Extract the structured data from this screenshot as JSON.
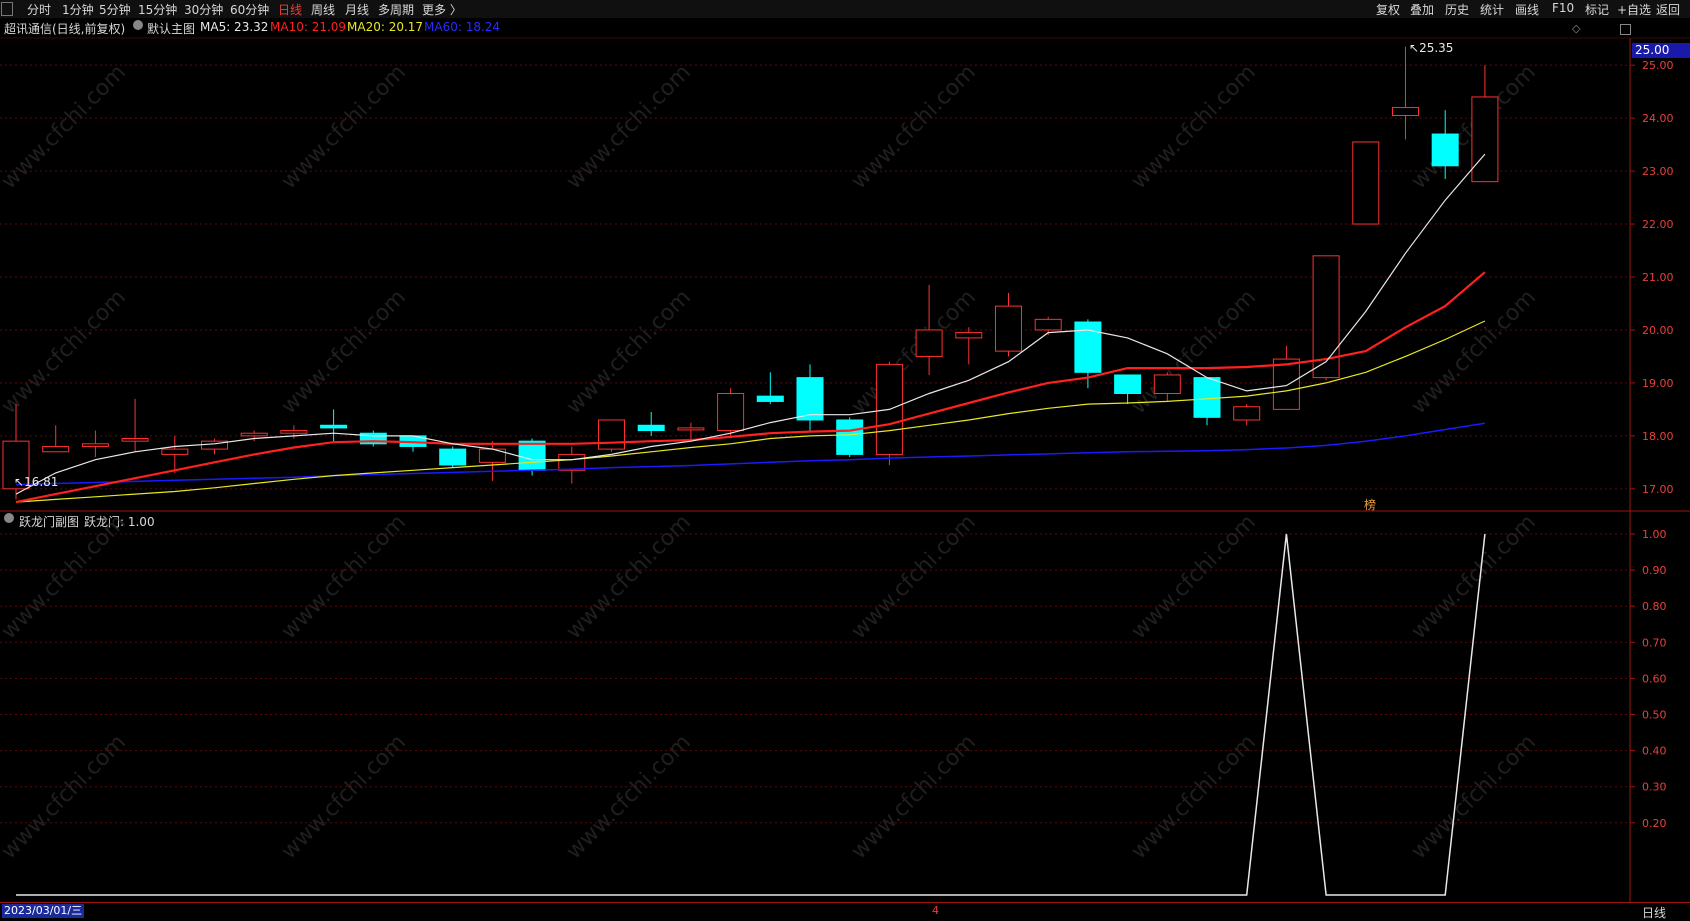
{
  "toolbar": {
    "left": [
      "分时",
      "1分钟",
      "5分钟",
      "15分钟",
      "30分钟",
      "60分钟",
      "日线",
      "周线",
      "月线",
      "多周期",
      "更多 〉"
    ],
    "active": "日线",
    "right": [
      "复权",
      "叠加",
      "历史",
      "统计",
      "画线",
      "F10",
      "标记",
      "+自选",
      "返回"
    ]
  },
  "info": {
    "stock": "超讯通信(日线,前复权)",
    "chart_name": "默认主图",
    "ma5": "MA5: 23.32",
    "ma10": "MA10: 21.09",
    "ma20": "MA20: 20.17",
    "ma60": "MA60: 18.24"
  },
  "colors": {
    "ma5": "#e8e8e8",
    "ma10": "#ff2020",
    "ma20": "#e8e820",
    "ma60": "#1a1aff",
    "up": "#ff3030",
    "down": "#00ffff",
    "grid": "#5a0a0a",
    "frame": "#a01414"
  },
  "sub": {
    "name": "跃龙门副图",
    "value": "跃龙门: 1.00"
  },
  "labels": {
    "high": "25.35",
    "low": "16.81",
    "current_price": "25.00",
    "mark": "榜"
  },
  "status": {
    "date": "2023/03/01/三",
    "period": "日线",
    "marker": "4"
  },
  "watermark": "www.cfchi.com",
  "chart_data": [
    {
      "type": "candlestick",
      "yticks": [
        "25.00",
        "24.00",
        "23.00",
        "22.00",
        "21.00",
        "20.00",
        "19.00",
        "18.00",
        "17.00"
      ],
      "ylim": [
        16.6,
        25.4
      ],
      "candles": [
        {
          "o": 17.0,
          "c": 17.9,
          "h": 18.6,
          "l": 16.8
        },
        {
          "o": 17.7,
          "c": 17.8,
          "h": 18.2,
          "l": 17.7
        },
        {
          "o": 17.8,
          "c": 17.85,
          "h": 18.1,
          "l": 17.6
        },
        {
          "o": 17.9,
          "c": 17.95,
          "h": 18.7,
          "l": 17.7
        },
        {
          "o": 17.65,
          "c": 17.75,
          "h": 18.0,
          "l": 17.3
        },
        {
          "o": 17.75,
          "c": 17.9,
          "h": 17.95,
          "l": 17.65
        },
        {
          "o": 18.0,
          "c": 18.05,
          "h": 18.1,
          "l": 17.9
        },
        {
          "o": 18.05,
          "c": 18.1,
          "h": 18.2,
          "l": 17.95
        },
        {
          "o": 18.2,
          "c": 18.15,
          "h": 18.5,
          "l": 17.9
        },
        {
          "o": 18.05,
          "c": 17.85,
          "h": 18.1,
          "l": 17.8
        },
        {
          "o": 18.0,
          "c": 17.8,
          "h": 18.0,
          "l": 17.7
        },
        {
          "o": 17.75,
          "c": 17.45,
          "h": 17.8,
          "l": 17.4
        },
        {
          "o": 17.5,
          "c": 17.75,
          "h": 17.9,
          "l": 17.15
        },
        {
          "o": 17.9,
          "c": 17.35,
          "h": 17.95,
          "l": 17.25
        },
        {
          "o": 17.35,
          "c": 17.65,
          "h": 17.8,
          "l": 17.1
        },
        {
          "o": 17.75,
          "c": 18.3,
          "h": 18.3,
          "l": 17.7
        },
        {
          "o": 18.2,
          "c": 18.1,
          "h": 18.45,
          "l": 18.0
        },
        {
          "o": 18.15,
          "c": 18.15,
          "h": 18.25,
          "l": 17.9
        },
        {
          "o": 18.1,
          "c": 18.8,
          "h": 18.9,
          "l": 18.0
        },
        {
          "o": 18.75,
          "c": 18.65,
          "h": 19.2,
          "l": 18.6
        },
        {
          "o": 19.1,
          "c": 18.3,
          "h": 19.35,
          "l": 18.1
        },
        {
          "o": 18.3,
          "c": 17.65,
          "h": 18.35,
          "l": 17.6
        },
        {
          "o": 17.65,
          "c": 19.35,
          "h": 19.4,
          "l": 17.45
        },
        {
          "o": 19.5,
          "c": 20.0,
          "h": 20.85,
          "l": 19.15
        },
        {
          "o": 19.85,
          "c": 19.95,
          "h": 20.05,
          "l": 19.35
        },
        {
          "o": 19.6,
          "c": 20.45,
          "h": 20.7,
          "l": 19.5
        },
        {
          "o": 20.0,
          "c": 20.2,
          "h": 20.25,
          "l": 19.9
        },
        {
          "o": 20.15,
          "c": 19.2,
          "h": 20.2,
          "l": 18.9
        },
        {
          "o": 19.15,
          "c": 18.8,
          "h": 19.15,
          "l": 18.6
        },
        {
          "o": 18.8,
          "c": 19.15,
          "h": 19.2,
          "l": 18.65
        },
        {
          "o": 19.1,
          "c": 18.35,
          "h": 19.1,
          "l": 18.2
        },
        {
          "o": 18.3,
          "c": 18.55,
          "h": 18.6,
          "l": 18.2
        },
        {
          "o": 18.5,
          "c": 19.45,
          "h": 19.7,
          "l": 18.5
        },
        {
          "o": 19.1,
          "c": 21.4,
          "h": 21.4,
          "l": 19.05
        },
        {
          "o": 22.0,
          "c": 23.55,
          "h": 23.55,
          "l": 22.0
        },
        {
          "o": 24.05,
          "c": 24.2,
          "h": 25.35,
          "l": 23.6
        },
        {
          "o": 23.7,
          "c": 23.1,
          "h": 24.15,
          "l": 22.85
        },
        {
          "o": 22.8,
          "c": 24.4,
          "h": 25.0,
          "l": 22.8
        }
      ],
      "ma5": [
        16.9,
        17.3,
        17.55,
        17.7,
        17.8,
        17.85,
        17.95,
        18.0,
        18.05,
        18.0,
        18.0,
        17.85,
        17.75,
        17.55,
        17.55,
        17.65,
        17.8,
        17.9,
        18.05,
        18.25,
        18.4,
        18.4,
        18.5,
        18.8,
        19.05,
        19.4,
        19.95,
        20.0,
        19.85,
        19.55,
        19.1,
        18.85,
        18.95,
        19.4,
        20.35,
        21.45,
        22.45,
        23.32
      ],
      "ma10": [
        16.75,
        16.9,
        17.05,
        17.2,
        17.35,
        17.5,
        17.65,
        17.78,
        17.88,
        17.9,
        17.88,
        17.85,
        17.85,
        17.85,
        17.85,
        17.87,
        17.9,
        17.92,
        17.98,
        18.05,
        18.08,
        18.1,
        18.22,
        18.42,
        18.62,
        18.82,
        19.0,
        19.1,
        19.28,
        19.28,
        19.28,
        19.3,
        19.35,
        19.45,
        19.6,
        20.05,
        20.45,
        21.09
      ],
      "ma20": [
        16.75,
        16.8,
        16.85,
        16.9,
        16.95,
        17.02,
        17.1,
        17.18,
        17.25,
        17.3,
        17.35,
        17.4,
        17.45,
        17.5,
        17.55,
        17.62,
        17.7,
        17.78,
        17.85,
        17.95,
        18.0,
        18.02,
        18.1,
        18.2,
        18.3,
        18.42,
        18.52,
        18.6,
        18.62,
        18.65,
        18.7,
        18.75,
        18.85,
        19.0,
        19.2,
        19.5,
        19.82,
        20.17
      ],
      "ma60": [
        17.08,
        17.1,
        17.12,
        17.14,
        17.16,
        17.18,
        17.2,
        17.22,
        17.25,
        17.27,
        17.29,
        17.31,
        17.33,
        17.35,
        17.37,
        17.4,
        17.42,
        17.44,
        17.47,
        17.5,
        17.53,
        17.55,
        17.58,
        17.6,
        17.62,
        17.64,
        17.66,
        17.68,
        17.7,
        17.71,
        17.72,
        17.74,
        17.77,
        17.82,
        17.9,
        18.0,
        18.12,
        18.24
      ]
    },
    {
      "type": "line",
      "name": "跃龙门",
      "yticks": [
        "1.00",
        "0.90",
        "0.80",
        "0.70",
        "0.60",
        "0.50",
        "0.40",
        "0.30",
        "0.20"
      ],
      "ylim": [
        0.0,
        1.0
      ],
      "values": [
        0,
        0,
        0,
        0,
        0,
        0,
        0,
        0,
        0,
        0,
        0,
        0,
        0,
        0,
        0,
        0,
        0,
        0,
        0,
        0,
        0,
        0,
        0,
        0,
        0,
        0,
        0,
        0,
        0,
        0,
        0,
        0,
        1,
        0,
        0,
        0,
        0,
        1
      ]
    }
  ]
}
